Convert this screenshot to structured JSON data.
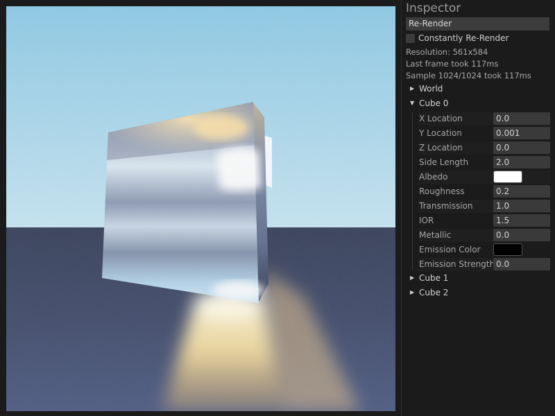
{
  "inspector": {
    "title": "Inspector",
    "rerender_button": "Re-Render",
    "constant_rerender_label": "Constantly Re-Render",
    "constant_rerender_checked": false,
    "resolution": "Resolution: 561x584",
    "last_frame": "Last frame took 117ms",
    "sample": "Sample 1024/1024 took 117ms"
  },
  "tree": {
    "world": "World",
    "cube0": "Cube 0",
    "cube1": "Cube 1",
    "cube2": "Cube 2"
  },
  "cube0_props": [
    {
      "label": "X Location",
      "value": "0.0"
    },
    {
      "label": "Y Location",
      "value": "0.001"
    },
    {
      "label": "Z Location",
      "value": "0.0"
    },
    {
      "label": "Side Length",
      "value": "2.0"
    },
    {
      "label": "Albedo",
      "color": "#ffffff"
    },
    {
      "label": "Roughness",
      "value": "0.2"
    },
    {
      "label": "Transmission",
      "value": "1.0"
    },
    {
      "label": "IOR",
      "value": "1.5"
    },
    {
      "label": "Metallic",
      "value": "0.0"
    },
    {
      "label": "Emission Color",
      "color": "#000000"
    },
    {
      "label": "Emission Strength",
      "value": "0.0"
    }
  ],
  "colors": {
    "sky_top": "#8fcbe6",
    "sky_horizon": "#c3e4f2",
    "ground_far": "#3a4460",
    "ground_near": "#46537a",
    "caustic": "#ffe9a8"
  }
}
